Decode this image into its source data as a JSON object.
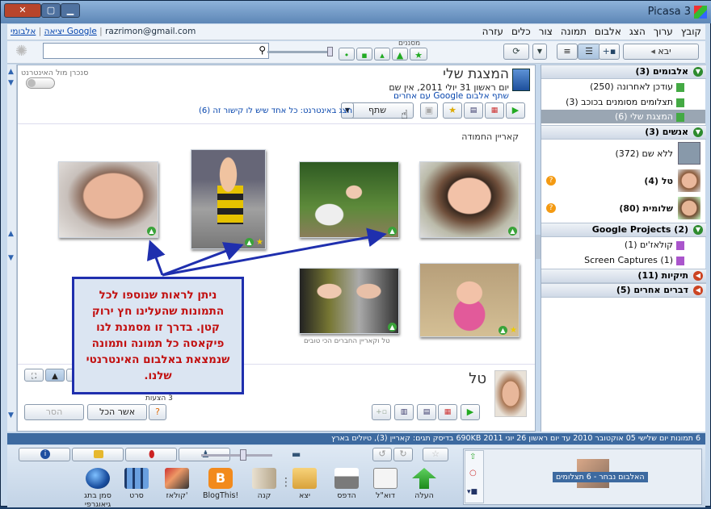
{
  "window": {
    "title": "Picasa 3",
    "minimize": "▁",
    "maximize": "▢",
    "close": "✕"
  },
  "menu": [
    "קובץ",
    "ערוך",
    "הצג",
    "אלבום",
    "תמונה",
    "צור",
    "כלים",
    "עזרה"
  ],
  "account": {
    "email": "razrimon@gmail.com",
    "albums_link": "אלבומי Google",
    "exit_link": "יציאה"
  },
  "toolbar": {
    "import_label": "יבא",
    "filters_label": "מסננים",
    "search_placeholder": ""
  },
  "sidebar": {
    "albums_header": "אלבומים (3)",
    "albums": [
      "עודכן לאחרונה (250)",
      "תצלומים מסומנים בכוכב (3)",
      "המצגת שלי (6)"
    ],
    "people_header": "אנשים (3)",
    "people": [
      {
        "label": "ללא שם (372)"
      },
      {
        "label": "טל (4)",
        "badge": "?"
      },
      {
        "label": "שלומית (80)",
        "badge": "?"
      }
    ],
    "projects_header": "Google Projects (2)",
    "projects": [
      "קולאז'ים (1)",
      "Screen Captures (1)"
    ],
    "folders_header": "תיקיות (11)",
    "other_header": "דברים אחרים (5)"
  },
  "album": {
    "title": "המצגת שלי",
    "date_line": "יום ראשון 31 יולי 2011, אין שם",
    "share_line": "שתף אלבום Google עם אחרים",
    "share_button": "שתף",
    "web_line": "הצג באינטרנט: כל אחד שיש לו קישור זה (6)",
    "sync_label": "סנכרן מול האינטרנט",
    "section_label": "קאריין החמודה",
    "caption_small": "טל וקאריין החברים הכי טובים"
  },
  "people_panel": {
    "name": "טל",
    "pending": "3 הצעות",
    "accept_all": "אשר הכל",
    "remove": "הסר"
  },
  "callout": "ניתן לראות שנוספו לכל התמונות שהעלינו חץ ירוק קטן. בדרך זו מסמנת לנו פיקאסה כל תמונה ותמונה שנמצאת באלבום האינטרנטי שלנו.",
  "status": "6 תמונות    יום שלישי 05 אוקטובר 2010 עד יום ראשון 26 יוני 2011    690KB בדיסק    תגים: קאריין (3), טיולים בארץ",
  "tray": {
    "label": "האלבום נבחר - 6 תצלומים"
  },
  "bottom_actions": [
    "העלה",
    "דוא\"ל",
    "הדפס",
    "יצא",
    "קנה",
    "BlogThis!",
    "קולאז'",
    "סרט",
    "סמן בתג גיאוגרפי"
  ]
}
